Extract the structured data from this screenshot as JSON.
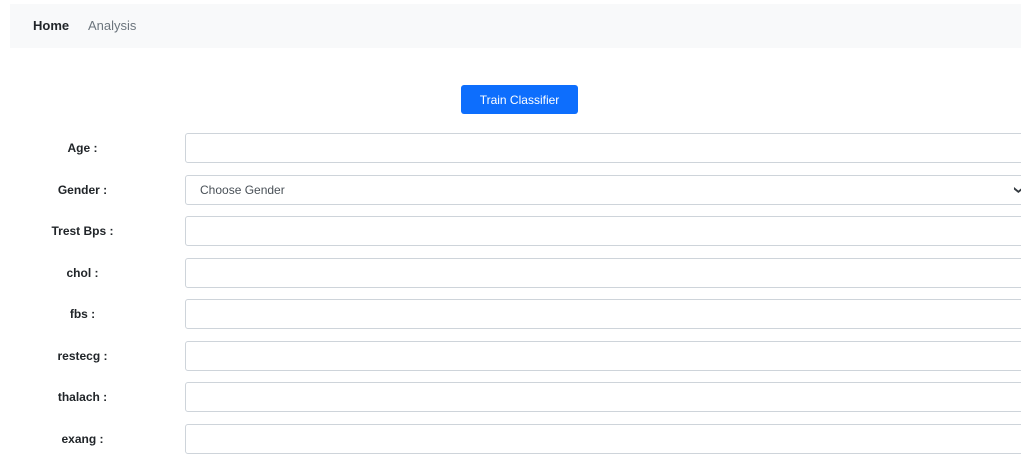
{
  "nav": {
    "home_label": "Home",
    "analysis_label": "Analysis"
  },
  "train_button_label": "Train Classifier",
  "form": {
    "age": {
      "label": "Age :",
      "value": ""
    },
    "gender": {
      "label": "Gender :",
      "selected": "Choose Gender"
    },
    "trestbps": {
      "label": "Trest Bps :",
      "value": ""
    },
    "chol": {
      "label": "chol :",
      "value": ""
    },
    "fbs": {
      "label": "fbs :",
      "value": ""
    },
    "restecg": {
      "label": "restecg :",
      "value": ""
    },
    "thalach": {
      "label": "thalach :",
      "value": ""
    },
    "exang": {
      "label": "exang :",
      "value": ""
    }
  },
  "icons": {
    "select_caret": "chevron-down-icon"
  },
  "colors": {
    "primary": "#0d6efd",
    "navbar_bg": "#f8f9fa",
    "input_border": "#ced4da"
  }
}
